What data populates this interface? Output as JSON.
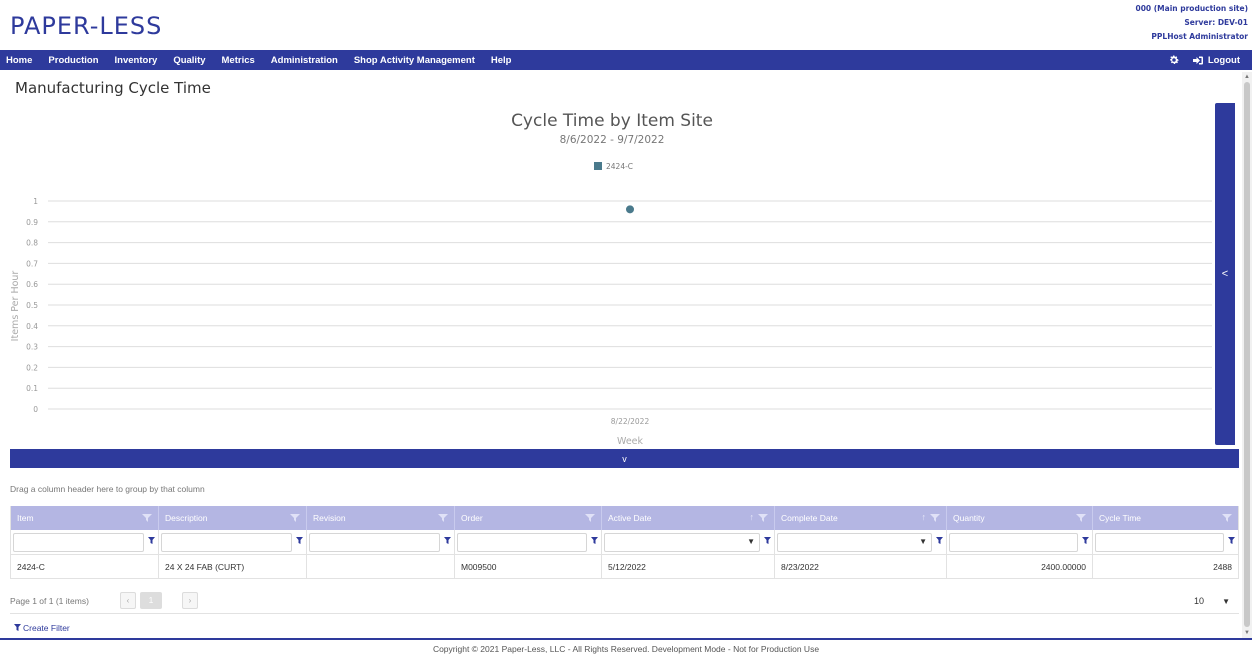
{
  "header": {
    "logo": "PAPER-LESS",
    "site": "000 (Main production site)",
    "server": "Server: DEV-01",
    "user": "PPLHost Administrator"
  },
  "nav": {
    "items": [
      "Home",
      "Production",
      "Inventory",
      "Quality",
      "Metrics",
      "Administration",
      "Shop Activity Management",
      "Help"
    ],
    "logout": "Logout"
  },
  "page_title": "Manufacturing Cycle Time",
  "chart_data": {
    "type": "scatter",
    "title": "Cycle Time by Item Site",
    "subtitle": "8/6/2022 - 9/7/2022",
    "ylabel": "Items Per Hour",
    "xlabel": "Week",
    "categories": [
      "8/22/2022"
    ],
    "series": [
      {
        "name": "2424-C",
        "values": [
          0.96
        ],
        "color": "#4a7a8c"
      }
    ],
    "ylim": [
      0,
      1
    ],
    "yticks": [
      "0",
      "0.1",
      "0.2",
      "0.3",
      "0.4",
      "0.5",
      "0.6",
      "0.7",
      "0.8",
      "0.9",
      "1"
    ],
    "grid": true,
    "legend": "top"
  },
  "side_panel": {
    "toggle": "<"
  },
  "collapse": {
    "label": "v"
  },
  "grid": {
    "group_hint": "Drag a column header here to group by that column",
    "columns": [
      "Item",
      "Description",
      "Revision",
      "Order",
      "Active Date",
      "Complete Date",
      "Quantity",
      "Cycle Time"
    ],
    "rows": [
      [
        "2424-C",
        "24 X 24 FAB (CURT)",
        "",
        "M009500",
        "5/12/2022",
        "8/23/2022",
        "2400.00000",
        "2488"
      ]
    ]
  },
  "pager": {
    "info": "Page 1 of 1 (1 items)",
    "current": "1",
    "page_size": "10"
  },
  "create_filter": "Create Filter",
  "footer": "Copyright © 2021 Paper-Less, LLC - All Rights Reserved. Development Mode - Not for Production Use",
  "colors": {
    "brand": "#2e3a9c",
    "grid_header": "#b4b6e3",
    "series": "#4a7a8c"
  }
}
